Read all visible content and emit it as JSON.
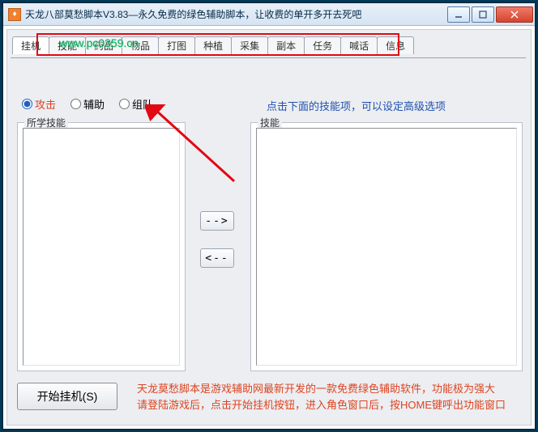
{
  "window": {
    "title": "天龙八部莫愁脚本V3.83—永久免费的绿色辅助脚本，让收费的单开多开去死吧"
  },
  "tabs": [
    "挂机",
    "技能",
    "药品",
    "物品",
    "打图",
    "种植",
    "采集",
    "副本",
    "任务",
    "喊话",
    "信息"
  ],
  "radios": {
    "attack": "攻击",
    "assist": "辅助",
    "team": "组队"
  },
  "hint": "点击下面的技能项，可以设定高级选项",
  "groupbox": {
    "left_title": "所学技能",
    "right_title": "技能"
  },
  "move": {
    "to_right": "-->",
    "to_left": "<--"
  },
  "start_button": "开始挂机(S)",
  "footer": {
    "line1": "天龙莫愁脚本是游戏辅助网最新开发的一款免费绿色辅助软件，功能极为强大",
    "line2": "请登陆游戏后，点击开始挂机按钮，进入角色窗口后，按HOME键呼出功能窗口"
  },
  "watermark": {
    "site": "www.pc0359.cn"
  }
}
